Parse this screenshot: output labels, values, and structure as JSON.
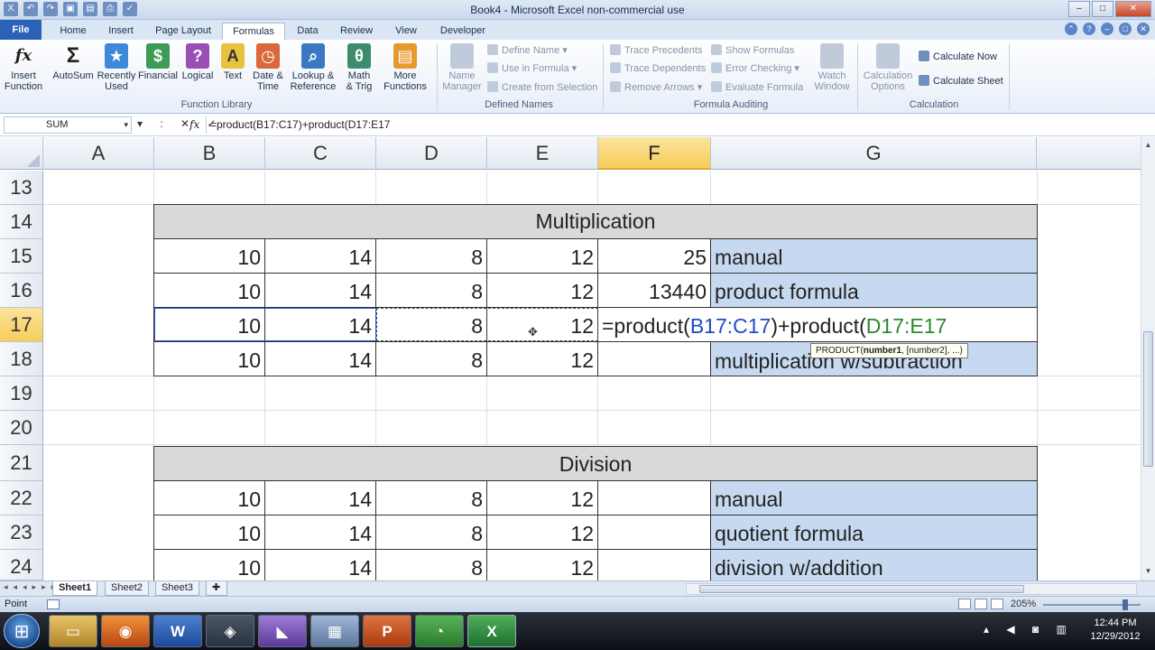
{
  "window": {
    "title": "Book4  -  Microsoft Excel non-commercial use",
    "controls": [
      "–",
      "□",
      "✕"
    ]
  },
  "tabs": {
    "file": "File",
    "items": [
      "Home",
      "Insert",
      "Page Layout",
      "Formulas",
      "Data",
      "Review",
      "View",
      "Developer"
    ],
    "active": "Formulas"
  },
  "ribbon": {
    "function_library": {
      "label": "Function Library",
      "buttons": [
        {
          "label": "Insert\nFunction",
          "icon": "fx"
        },
        {
          "label": "AutoSum",
          "icon": "Σ"
        },
        {
          "label": "Recently\nUsed",
          "icon": "★"
        },
        {
          "label": "Financial",
          "icon": "$"
        },
        {
          "label": "Logical",
          "icon": "?"
        },
        {
          "label": "Text",
          "icon": "A"
        },
        {
          "label": "Date &\nTime",
          "icon": "◷"
        },
        {
          "label": "Lookup &\nReference",
          "icon": "⌕"
        },
        {
          "label": "Math\n& Trig",
          "icon": "θ"
        },
        {
          "label": "More\nFunctions",
          "icon": "▤"
        }
      ]
    },
    "defined_names": {
      "label": "Defined Names",
      "name_manager": "Name\nManager",
      "define_name": "Define Name",
      "use_in_formula": "Use in Formula",
      "create_from_selection": "Create from Selection"
    },
    "formula_auditing": {
      "label": "Formula Auditing",
      "trace_precedents": "Trace Precedents",
      "trace_dependents": "Trace Dependents",
      "remove_arrows": "Remove Arrows",
      "show_formulas": "Show Formulas",
      "error_checking": "Error Checking",
      "evaluate_formula": "Evaluate Formula",
      "watch_window": "Watch\nWindow"
    },
    "calculation": {
      "label": "Calculation",
      "calculation_options": "Calculation\nOptions",
      "calculate_now": "Calculate Now",
      "calculate_sheet": "Calculate Sheet"
    }
  },
  "formula_bar": {
    "name_box": "SUM",
    "buttons": "▾ : ✕ ✓",
    "fx": "fx",
    "formula": "=product(B17:C17)+product(D17:E17"
  },
  "columns": [
    "A",
    "B",
    "C",
    "D",
    "E",
    "F",
    "G"
  ],
  "selected_column": "F",
  "rows": [
    "13",
    "14",
    "15",
    "16",
    "17",
    "18",
    "19",
    "20",
    "21",
    "22",
    "23",
    "24"
  ],
  "selected_row": "17",
  "sheet": {
    "multiplication_header": "Multiplication",
    "mult_rows": [
      {
        "b": "10",
        "c": "14",
        "d": "8",
        "e": "12",
        "f": "25",
        "g": "manual"
      },
      {
        "b": "10",
        "c": "14",
        "d": "8",
        "e": "12",
        "f": "13440",
        "g": "product formula"
      },
      {
        "b": "10",
        "c": "14",
        "d": "8",
        "e": "12",
        "f": "",
        "g": ""
      },
      {
        "b": "10",
        "c": "14",
        "d": "8",
        "e": "12",
        "f": "",
        "g": "multiplication w/subtraction"
      }
    ],
    "editing_formula": {
      "prefix": "=product(",
      "ref1": "B17:C17",
      "middle": ")+product(",
      "ref2": "D17:E17"
    },
    "tooltip": {
      "fn": "PRODUCT(",
      "arg1": "number1",
      "rest": ", [number2], ...)"
    },
    "division_header": "Division",
    "div_rows": [
      {
        "b": "10",
        "c": "14",
        "d": "8",
        "e": "12",
        "f": "",
        "g": "manual"
      },
      {
        "b": "10",
        "c": "14",
        "d": "8",
        "e": "12",
        "f": "",
        "g": "quotient formula"
      },
      {
        "b": "10",
        "c": "14",
        "d": "8",
        "e": "12",
        "f": "",
        "g": "division w/addition"
      }
    ]
  },
  "sheet_tabs": [
    "Sheet1",
    "Sheet2",
    "Sheet3"
  ],
  "active_sheet": "Sheet1",
  "status": {
    "mode": "Point",
    "zoom": "205%"
  },
  "taskbar": {
    "apps": [
      "explorer",
      "firefox",
      "word",
      "media",
      "paint",
      "calculator",
      "powerpoint",
      "stream",
      "excel"
    ],
    "time": "12:44 PM",
    "date": "12/29/2012"
  },
  "colors": {
    "header_fill": "#d9d9d9",
    "label_fill": "#c6d9f0",
    "ref_blue": "#1f49c9",
    "ref_green": "#2a8a2a",
    "selected_header": "#f7cd5a"
  }
}
